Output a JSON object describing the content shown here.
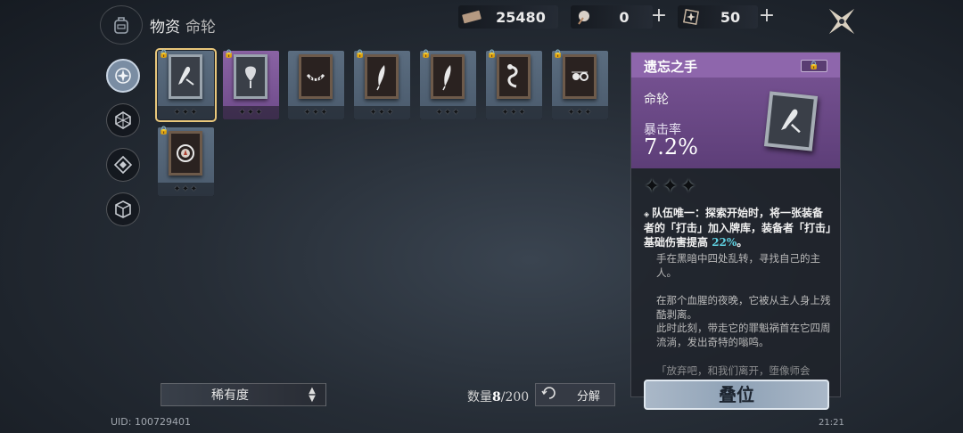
{
  "header": {
    "title_main": "物资",
    "title_sub": "命轮",
    "currencies": [
      {
        "icon": "ticket-icon",
        "value": "25480"
      },
      {
        "icon": "ink-pen-icon",
        "value": "0"
      },
      {
        "icon": "star-card-icon",
        "value": "50"
      }
    ]
  },
  "nav": {
    "items": [
      {
        "name": "wheel",
        "icon": "compass-wheel-icon",
        "active": true
      },
      {
        "name": "crystal",
        "icon": "crystal-icon",
        "active": false
      },
      {
        "name": "diamond",
        "icon": "diamond-emblem-icon",
        "active": false
      },
      {
        "name": "box",
        "icon": "cube-icon",
        "active": false
      }
    ]
  },
  "cards": [
    {
      "rarity": "blue",
      "selected": true,
      "stars": "✦✦✦",
      "locked": true,
      "art": "hand-icon"
    },
    {
      "rarity": "purple",
      "selected": false,
      "stars": "✦✦✦",
      "locked": true,
      "art": "rose-icon"
    },
    {
      "rarity": "blue",
      "selected": false,
      "stars": "✦✦✦",
      "locked": false,
      "art": "smile-icon"
    },
    {
      "rarity": "blue",
      "selected": false,
      "stars": "✦✦✦",
      "locked": true,
      "art": "feather-icon"
    },
    {
      "rarity": "blue",
      "selected": false,
      "stars": "✦✦✦",
      "locked": true,
      "art": "feather-icon"
    },
    {
      "rarity": "blue",
      "selected": false,
      "stars": "✦✦✦",
      "locked": true,
      "art": "serpent-icon"
    },
    {
      "rarity": "blue",
      "selected": false,
      "stars": "✦✦✦",
      "locked": true,
      "art": "mask-icon"
    },
    {
      "rarity": "blue",
      "selected": false,
      "stars": "✦✦✦",
      "locked": true,
      "art": "coin-icon"
    }
  ],
  "detail": {
    "name": "遗忘之手",
    "lock_label": "🔒",
    "type": "命轮",
    "stat_label": "暴击率",
    "stat_value": "7.2%",
    "stars": "✦✦✦",
    "effect_prefix": "队伍唯一：探索开始时，将一张装备者的「打击」加入牌库，装备者「打击」基础伤害提高 ",
    "effect_highlight": "22%",
    "effect_suffix": "。",
    "lore_1": "手在黑暗中四处乱转，寻找自己的主人。",
    "lore_2": "在那个血腥的夜晚，它被从主人身上残酷剥离。",
    "lore_3": "此时此刻，带走它的罪魁祸首在它四周流淌，发出奇特的嗡鸣。",
    "lore_4": "「放弃吧，和我们离开，堕像师会"
  },
  "footer": {
    "sort_label": "稀有度",
    "count_prefix": "数量",
    "count_current": "8",
    "count_total": "/200",
    "decompose_label": "分解",
    "stack_label": "叠位",
    "uid": "UID: 100729401",
    "clock": "21:21"
  },
  "colors": {
    "accent_purple": "#8e66ac",
    "card_blue": "#5b6d80",
    "highlight_cyan": "#5fd0e0",
    "selected_outline": "#e9c77b"
  }
}
